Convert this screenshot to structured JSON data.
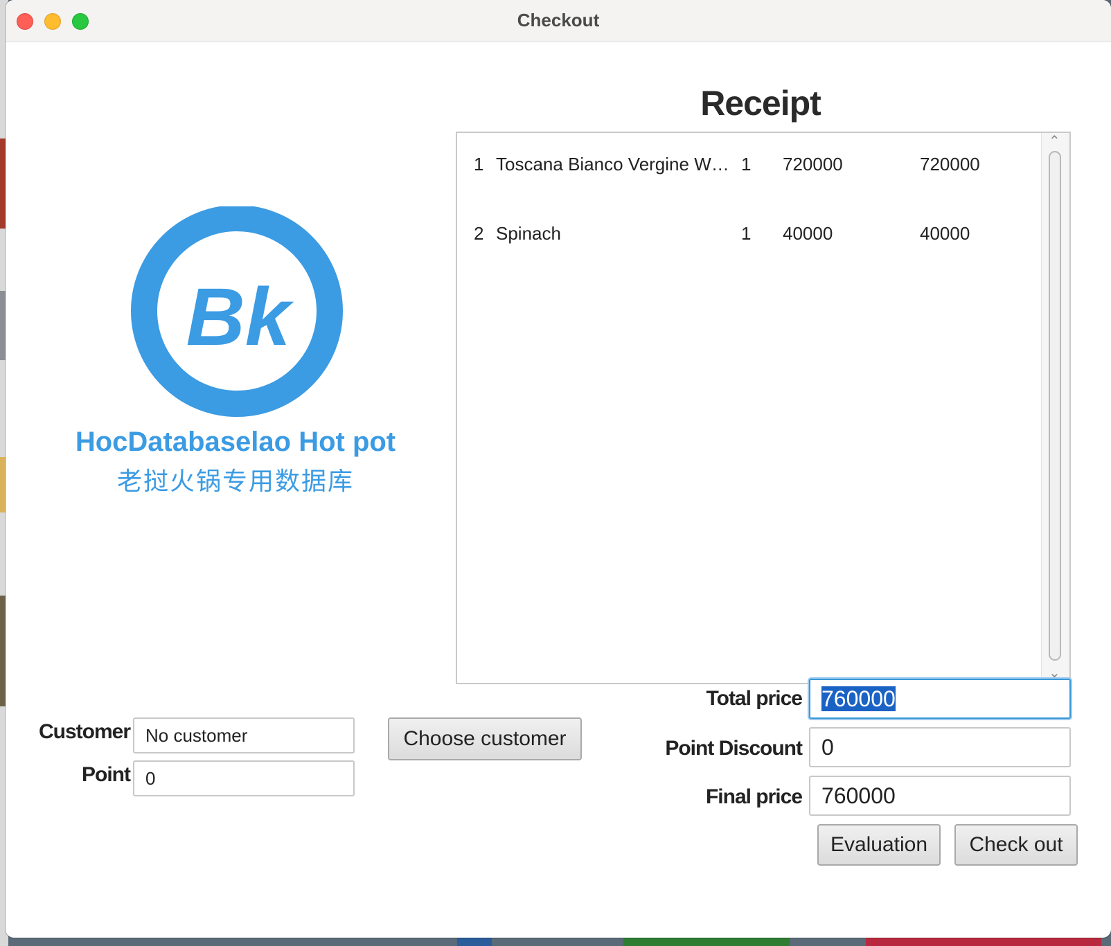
{
  "window": {
    "title": "Checkout"
  },
  "receipt": {
    "title": "Receipt",
    "rows": [
      {
        "index": "1",
        "name": "Toscana Bianco Vergine Whit...",
        "qty": "1",
        "price": "720000",
        "total": "720000"
      },
      {
        "index": "2",
        "name": "Spinach",
        "qty": "1",
        "price": "40000",
        "total": "40000"
      }
    ]
  },
  "brand": {
    "logo_text": "Bk",
    "name": "HocDatabaselao Hot pot",
    "subtitle": "老挝火锅专用数据库",
    "color": "#3b9be3"
  },
  "customer": {
    "label": "Customer",
    "value": "No customer",
    "point_label": "Point",
    "point_value": "0",
    "choose_button": "Choose customer"
  },
  "totals": {
    "total_label": "Total price",
    "total_value": "760000",
    "discount_label": "Point Discount",
    "discount_value": "0",
    "final_label": "Final price",
    "final_value": "760000"
  },
  "actions": {
    "evaluation": "Evaluation",
    "checkout": "Check out"
  },
  "icons": {
    "scroll_up": "chevron-up-icon",
    "scroll_down": "chevron-down-icon"
  }
}
